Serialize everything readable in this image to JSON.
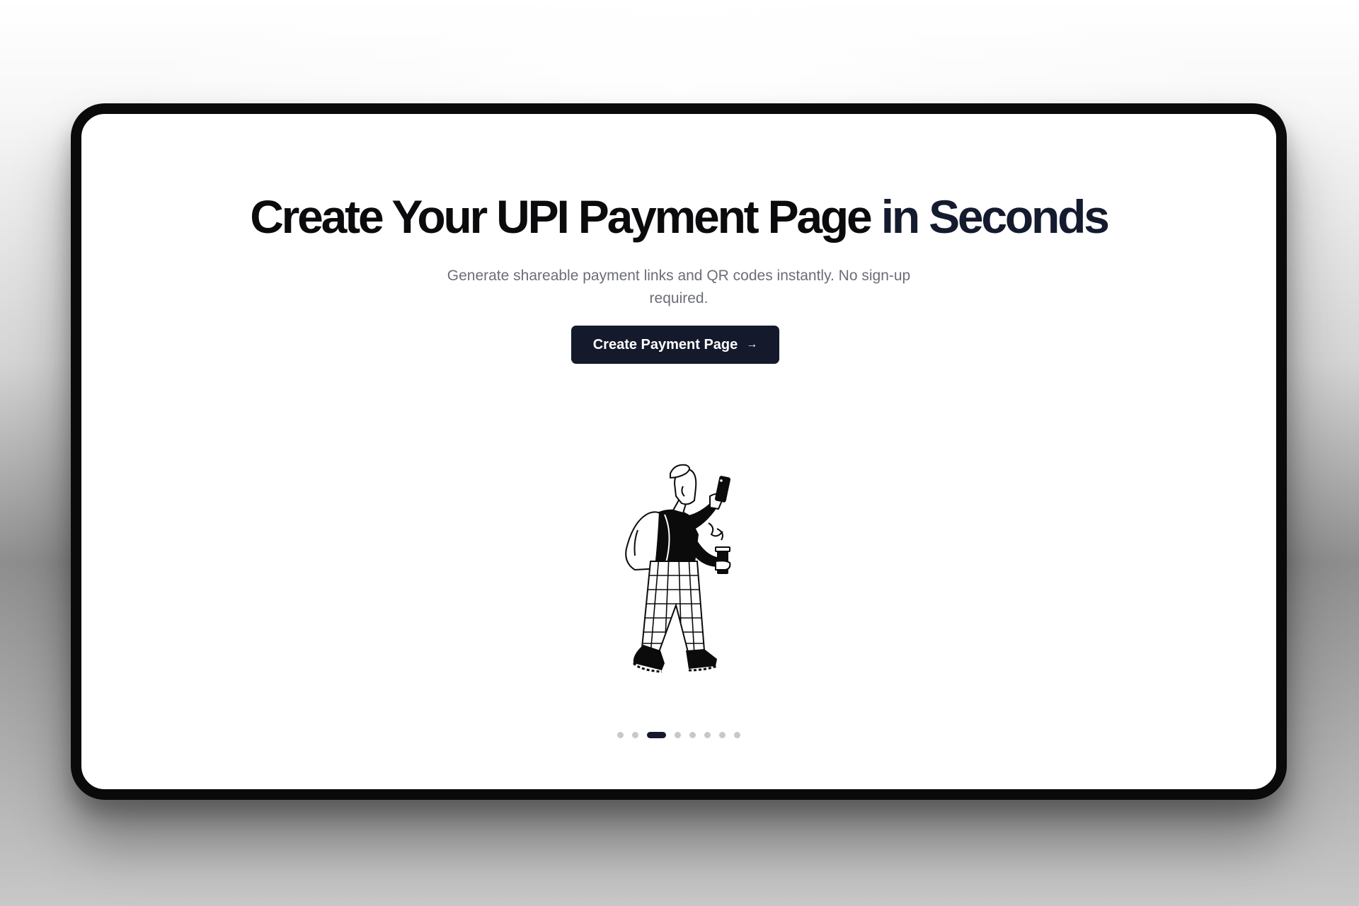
{
  "hero": {
    "headline_part1": "Create Your UPI Payment Page",
    "headline_part2": "in Seconds",
    "subtitle": "Generate shareable payment links and QR codes instantly. No sign-up required.",
    "cta_label": "Create Payment Page",
    "cta_icon": "arrow-right-icon",
    "illustration": "person-walking-with-phone-and-coffee-illustration"
  },
  "carousel": {
    "total_slides": 8,
    "active_index": 2
  },
  "colors": {
    "primary": "#141a2b",
    "headline": "#0b0b0d",
    "subtitle": "#6b6e76",
    "dot_inactive": "#c7c8cc",
    "frame": "#0a0a0a"
  }
}
